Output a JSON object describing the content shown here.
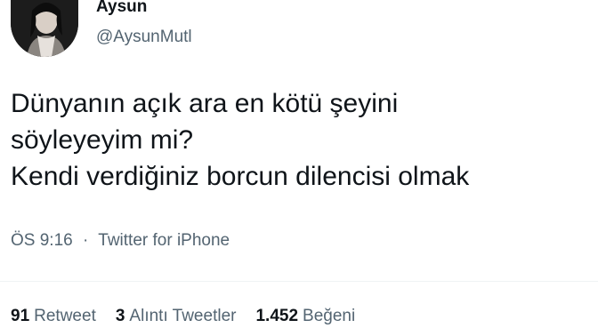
{
  "author": {
    "display_name": "Aysun",
    "handle": "@AysunMutl"
  },
  "tweet": {
    "lines": [
      "Dünyanın açık ara en kötü şeyini",
      "söyleyeyim mi?",
      "Kendi verdiğiniz borcun dilencisi olmak"
    ]
  },
  "meta": {
    "time": "ÖS 9:16",
    "separator": "·",
    "source": "Twitter for iPhone"
  },
  "stats": [
    {
      "count": "91",
      "label": "Retweet"
    },
    {
      "count": "3",
      "label": "Alıntı Tweetler"
    },
    {
      "count": "1.452",
      "label": "Beğeni"
    }
  ],
  "colors": {
    "text_primary": "#0f1419",
    "text_secondary": "#536471",
    "divider": "#eff3f4"
  }
}
